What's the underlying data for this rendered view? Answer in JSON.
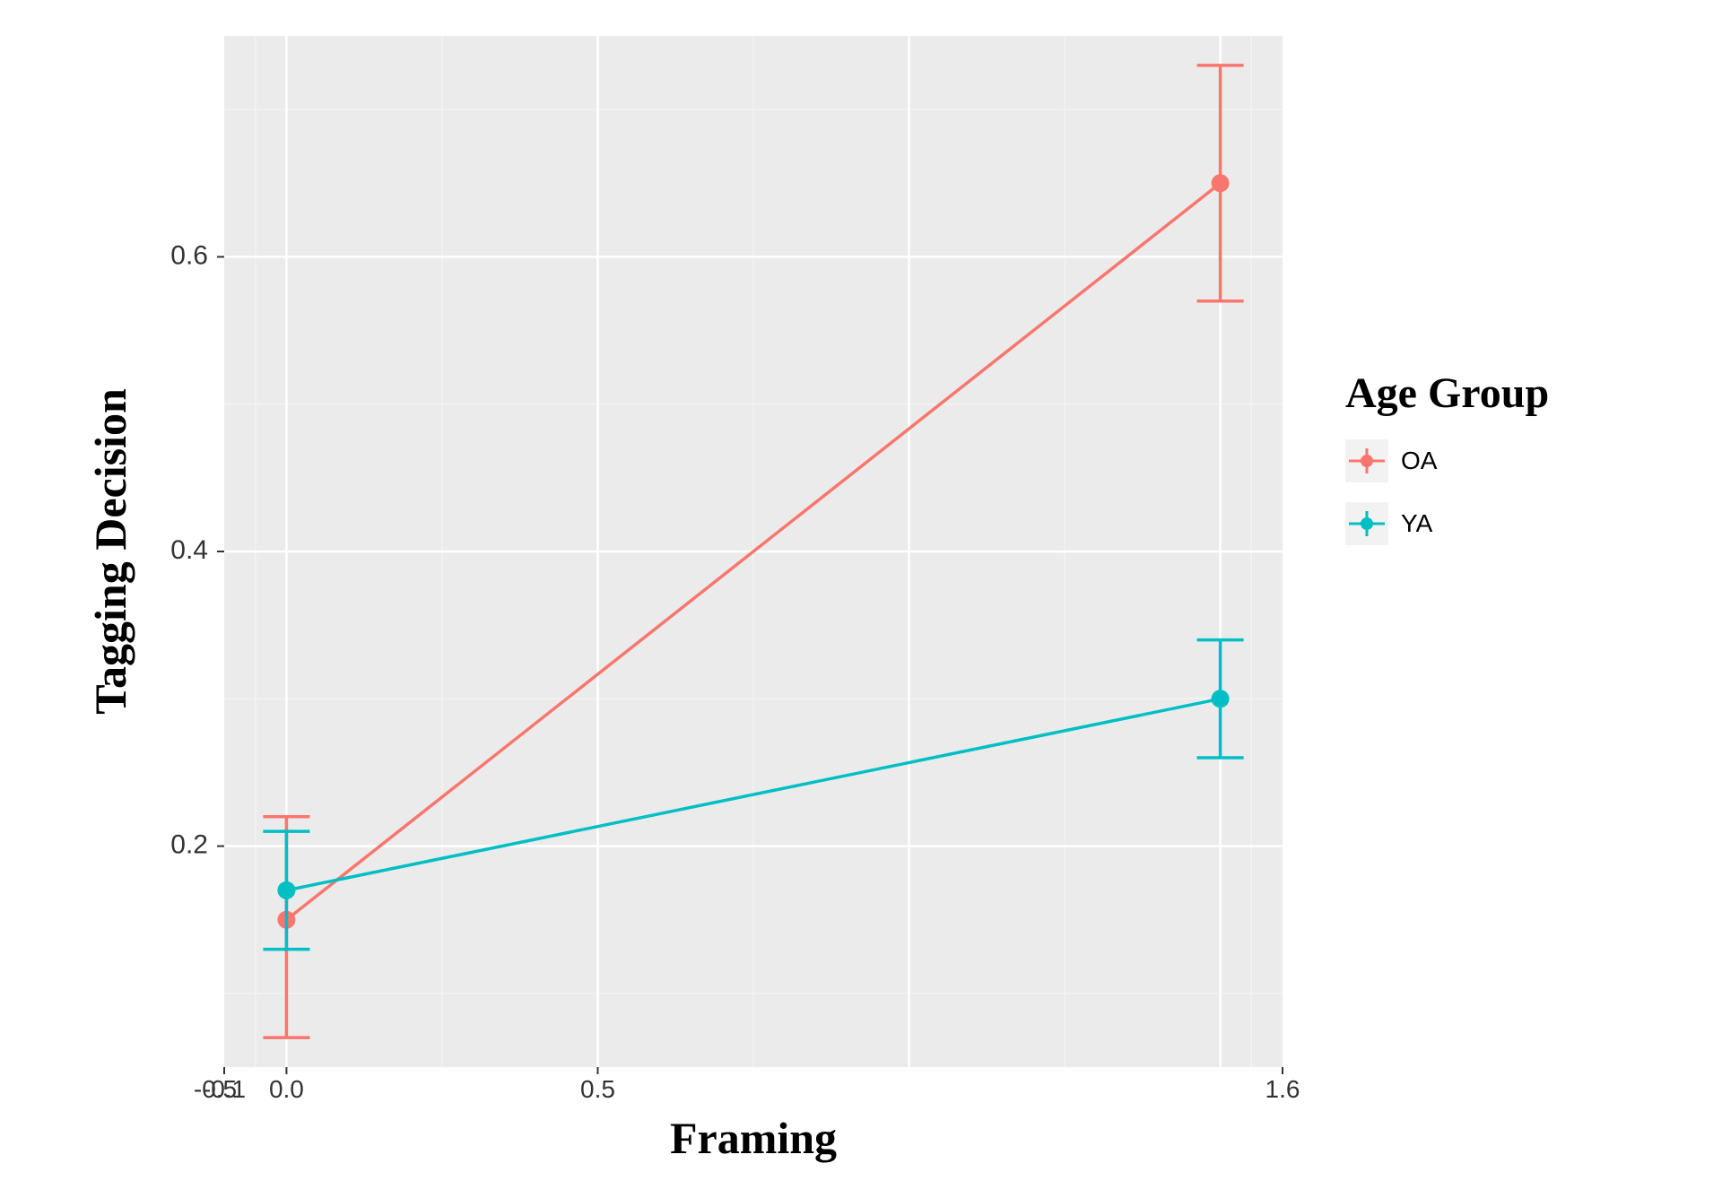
{
  "chart_data": {
    "type": "line",
    "xlabel": "Framing",
    "ylabel": "Tagging Decision",
    "legend_title": "Age Group",
    "x_ticks": [
      -0.1,
      -0.5,
      0.0,
      0.5,
      1.6
    ],
    "x_tick_labels": [
      "-0.1",
      "-0.5",
      "0.0",
      "0.5",
      "1.6"
    ],
    "y_ticks": [
      0.2,
      0.4,
      0.6
    ],
    "ylim": [
      0.05,
      0.75
    ],
    "xlim": [
      -0.1,
      1.6
    ],
    "series": [
      {
        "name": "OA",
        "color": "#F8766D",
        "points": [
          {
            "x": 0.0,
            "y": 0.15,
            "err_low": 0.07,
            "err_high": 0.22
          },
          {
            "x": 1.5,
            "y": 0.65,
            "err_low": 0.57,
            "err_high": 0.73
          }
        ]
      },
      {
        "name": "YA",
        "color": "#00BFC4",
        "points": [
          {
            "x": 0.0,
            "y": 0.17,
            "err_low": 0.13,
            "err_high": 0.21
          },
          {
            "x": 1.5,
            "y": 0.3,
            "err_low": 0.26,
            "err_high": 0.34
          }
        ]
      }
    ]
  }
}
